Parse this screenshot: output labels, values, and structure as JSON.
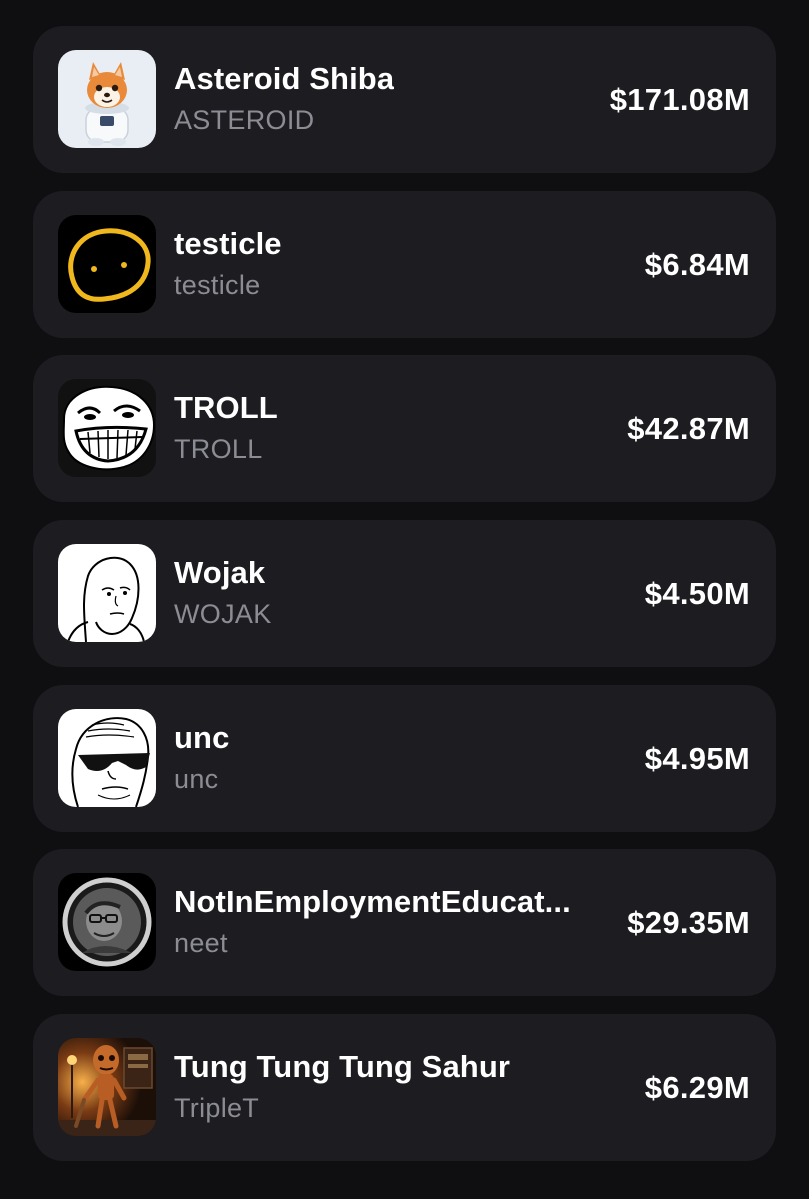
{
  "tokens": [
    {
      "name": "Asteroid Shiba",
      "symbol": "ASTEROID",
      "market_cap": "$171.08M",
      "icon": "shiba-astronaut-icon"
    },
    {
      "name": "testicle",
      "symbol": "testicle",
      "market_cap": "$6.84M",
      "icon": "yellow-blob-face-icon"
    },
    {
      "name": "TROLL",
      "symbol": "TROLL",
      "market_cap": "$42.87M",
      "icon": "trollface-icon"
    },
    {
      "name": "Wojak",
      "symbol": "WOJAK",
      "market_cap": "$4.50M",
      "icon": "wojak-icon"
    },
    {
      "name": "unc",
      "symbol": "unc",
      "market_cap": "$4.95M",
      "icon": "sunglasses-face-icon"
    },
    {
      "name": "NotInEmploymentEducat...",
      "symbol": "neet",
      "market_cap": "$29.35M",
      "icon": "neet-circle-portrait-icon"
    },
    {
      "name": "Tung Tung Tung Sahur",
      "symbol": "TripleT",
      "market_cap": "$6.29M",
      "icon": "wooden-figure-icon"
    }
  ],
  "colors": {
    "background": "#0f0f12",
    "card": "#1c1c21",
    "primary_text": "#ffffff",
    "secondary_text": "#8c8c94"
  }
}
